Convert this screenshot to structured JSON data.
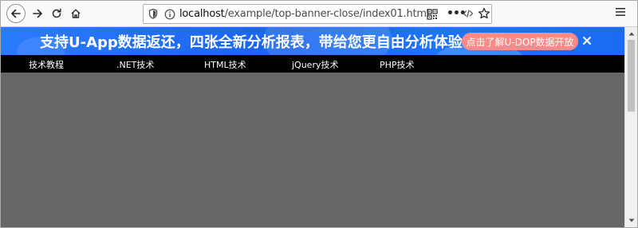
{
  "browser": {
    "url_host": "localhost",
    "url_path": "/example/top-banner-close/index01.html",
    "icons": [
      "back-icon",
      "forward-icon",
      "reload-icon",
      "home-icon",
      "shield-icon",
      "info-icon",
      "qr-code-icon",
      "more-icon",
      "reader-icon",
      "star-icon",
      "menu-icon"
    ],
    "more_label": "•••"
  },
  "banner": {
    "text": "支持U-App数据返还，四张全新分析报表，带给您更自由分析体验！",
    "cta_label": "点击了解U-DOP数据开放",
    "close_label": "✕"
  },
  "nav": {
    "items": [
      "技术教程",
      ".NET技术",
      "HTML技术",
      "jQuery技术",
      "PHP技术"
    ]
  },
  "colors": {
    "banner_bg": "#1a64f0",
    "cta_bg": "#ff8a8a",
    "nav_bg": "#000000",
    "page_bg": "#666666"
  }
}
